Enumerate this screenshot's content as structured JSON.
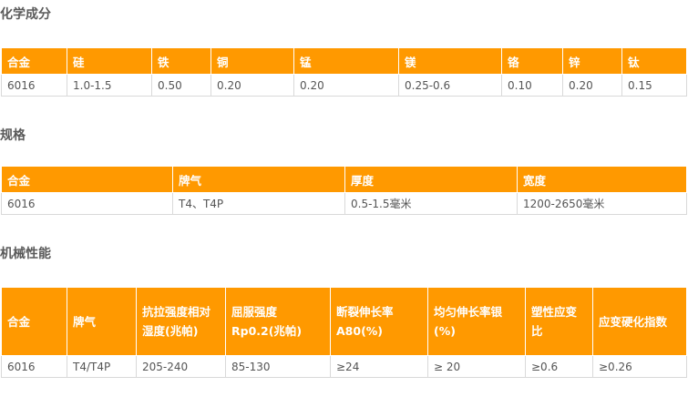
{
  "chemical": {
    "title": "化学成分",
    "headers": [
      "合金",
      "硅",
      "铁",
      "铜",
      "锰",
      "镁",
      "铬",
      "锌",
      "钛"
    ],
    "rows": [
      [
        "6016",
        "1.0-1.5",
        "0.50",
        "0.20",
        "0.20",
        "0.25-0.6",
        "0.10",
        "0.20",
        "0.15"
      ]
    ]
  },
  "spec": {
    "title": "规格",
    "headers": [
      "合金",
      "牌气",
      "厚度",
      "宽度"
    ],
    "rows": [
      [
        "6016",
        "T4、T4P",
        "0.5-1.5毫米",
        "1200-2650毫米"
      ]
    ]
  },
  "mechanical": {
    "title": "机械性能",
    "headers": [
      "合金",
      "牌气",
      "抗拉强度相对湿度(兆帕)",
      "屈服强度Rp0.2(兆帕)",
      "断裂伸长率A80(%)",
      "均匀伸长率银 (%)",
      "塑性应变比",
      "应变硬化指数"
    ],
    "rows": [
      [
        "6016",
        "T4/T4P",
        "205-240",
        "85-130",
        "≥24",
        "≥ 20",
        "≥0.6",
        "≥0.26"
      ]
    ]
  }
}
